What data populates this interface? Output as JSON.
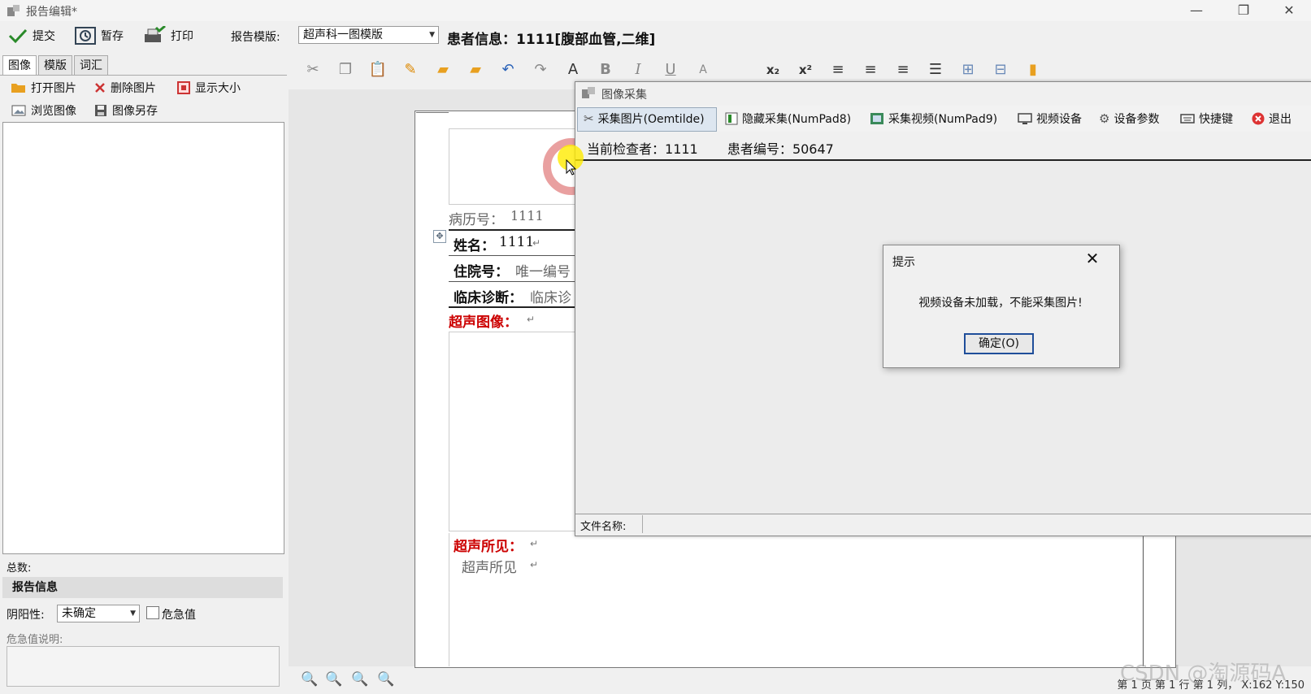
{
  "window": {
    "title": "报告编辑*",
    "minimize": "—",
    "restore": "❐",
    "close": "✕"
  },
  "toolbar": {
    "submit": "提交",
    "save_draft": "暂存",
    "print": "打印",
    "template_label": "报告模版:",
    "template_value": "超声科一图模版",
    "patient_info": "患者信息：1111[腹部血管,二维]"
  },
  "left_tabs": [
    "图像",
    "模版",
    "词汇"
  ],
  "image_actions": {
    "open": "打开图片",
    "delete": "删除图片",
    "show_size": "显示大小",
    "browse": "浏览图像",
    "save_as": "图像另存"
  },
  "left_panel": {
    "total_label": "总数:",
    "report_info": "报告信息",
    "posneg_label": "阴阳性:",
    "posneg_value": "未确定",
    "urgent_label": "危急值",
    "urgent_desc_label": "危急值说明:"
  },
  "document": {
    "record_no_label": "病历号：",
    "record_no": "1111",
    "name_label": "姓名：",
    "name": "1111",
    "inpatient_label": "住院号：",
    "inpatient": "唯一编号",
    "diagnosis_label": "临床诊断：",
    "diagnosis": "临床诊",
    "us_image_label": "超声图像：",
    "findings_label": "超声所见：",
    "findings": "超声所见",
    "return_mark": "↵"
  },
  "capture": {
    "title": "图像采集",
    "buttons": [
      "采集图片(Oemtilde)",
      "隐藏采集(NumPad8)",
      "采集视频(NumPad9)",
      "视频设备",
      "设备参数",
      "快捷键",
      "退出"
    ],
    "examiner_label": "当前检查者：",
    "examiner": "1111",
    "patient_no_label": "患者编号：",
    "patient_no": "50647",
    "filename_label": "文件名称:"
  },
  "dialog": {
    "title": "提示",
    "message": "视频设备未加载，不能采集图片!",
    "ok": "确定(O)",
    "close": "✕"
  },
  "status": {
    "text": "第 1 页 第 1 行 第 1 列， X:162 Y:150"
  },
  "watermark": "CSDN @淘源码A",
  "colors": {
    "accent_red": "#cc0000",
    "dialog_border": "#1f4e9a"
  }
}
